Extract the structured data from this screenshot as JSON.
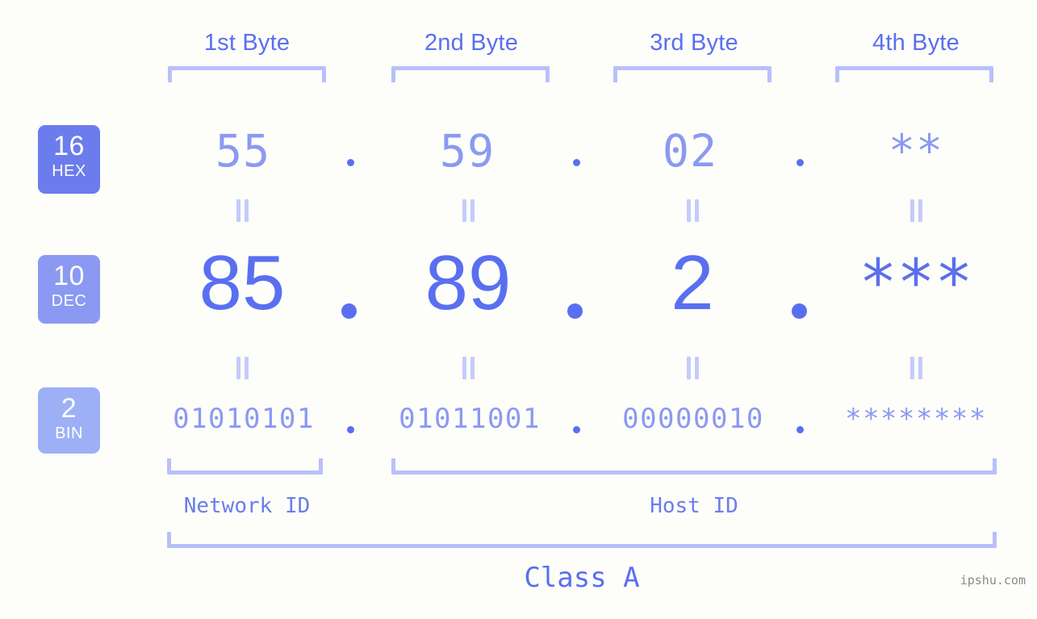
{
  "background_color": "#fdfefa",
  "colors": {
    "accent_strong": "#5a6ff0",
    "accent_mid": "#8b99f2",
    "accent_light": "#b8c0fb",
    "badge_hex": "#6b7cec",
    "badge_dec": "#8b99f2",
    "badge_bin": "#9db0f6",
    "watermark": "#8a8a8a"
  },
  "byte_headers": [
    {
      "label": "1st Byte"
    },
    {
      "label": "2nd Byte"
    },
    {
      "label": "3rd Byte"
    },
    {
      "label": "4th Byte"
    }
  ],
  "bases": [
    {
      "number": "16",
      "name": "HEX"
    },
    {
      "number": "10",
      "name": "DEC"
    },
    {
      "number": "2",
      "name": "BIN"
    }
  ],
  "rows": {
    "hex": {
      "base_number": "16",
      "base_name": "HEX",
      "values": [
        "55",
        "59",
        "02",
        "**"
      ]
    },
    "dec": {
      "base_number": "10",
      "base_name": "DEC",
      "values": [
        "85",
        "89",
        "2",
        "***"
      ]
    },
    "bin": {
      "base_number": "2",
      "base_name": "BIN",
      "values": [
        "01010101",
        "01011001",
        "00000010",
        "********"
      ]
    }
  },
  "separator": ".",
  "equals_mark": "=",
  "id_labels": {
    "network": "Network ID",
    "host": "Host ID"
  },
  "class_label": "Class A",
  "watermark": "ipshu.com"
}
